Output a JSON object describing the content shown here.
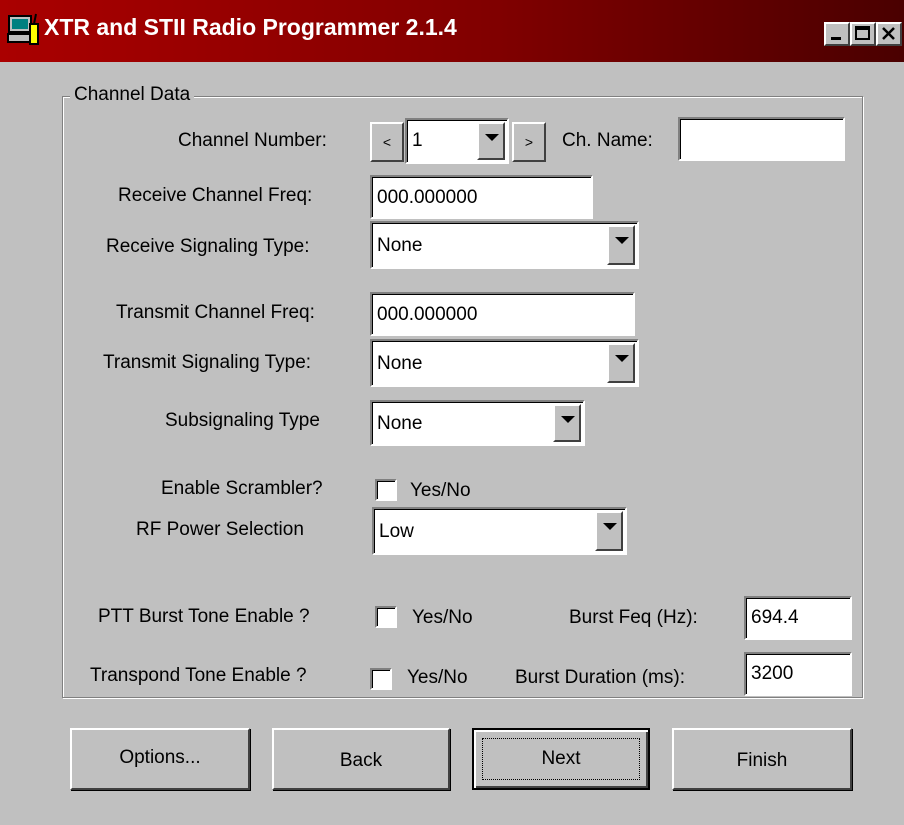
{
  "window": {
    "title": "XTR and STII Radio Programmer 2.1.4",
    "title_bar_color": "#800000",
    "icon": "computer-radio-icon"
  },
  "group": {
    "label": "Channel Data"
  },
  "channel": {
    "number_label": "Channel Number:",
    "prev_label": "<",
    "number_value": "1",
    "next_label": ">",
    "name_label": "Ch. Name:",
    "name_value": ""
  },
  "receive": {
    "freq_label": "Receive Channel Freq:",
    "freq_value": "000.000000",
    "signaling_label": "Receive Signaling Type:",
    "signaling_value": "None"
  },
  "transmit": {
    "freq_label": "Transmit Channel Freq:",
    "freq_value": "000.000000",
    "signaling_label": "Transmit Signaling Type:",
    "signaling_value": "None"
  },
  "subsignaling": {
    "label": "Subsignaling Type",
    "value": "None"
  },
  "scrambler": {
    "label": "Enable Scrambler?",
    "checkbox_label": "Yes/No",
    "checked": false
  },
  "rf_power": {
    "label": "RF Power Selection",
    "value": "Low"
  },
  "ptt_burst": {
    "label": "PTT Burst Tone Enable ?",
    "checkbox_label": "Yes/No",
    "checked": false
  },
  "transpond": {
    "label": "Transpond Tone Enable ?",
    "checkbox_label": "Yes/No",
    "checked": false
  },
  "burst_freq": {
    "label": "Burst Feq (Hz):",
    "value": "694.4"
  },
  "burst_duration": {
    "label": "Burst Duration (ms):",
    "value": "3200"
  },
  "buttons": {
    "options": "Options...",
    "back": "Back",
    "next": "Next",
    "finish": "Finish"
  }
}
